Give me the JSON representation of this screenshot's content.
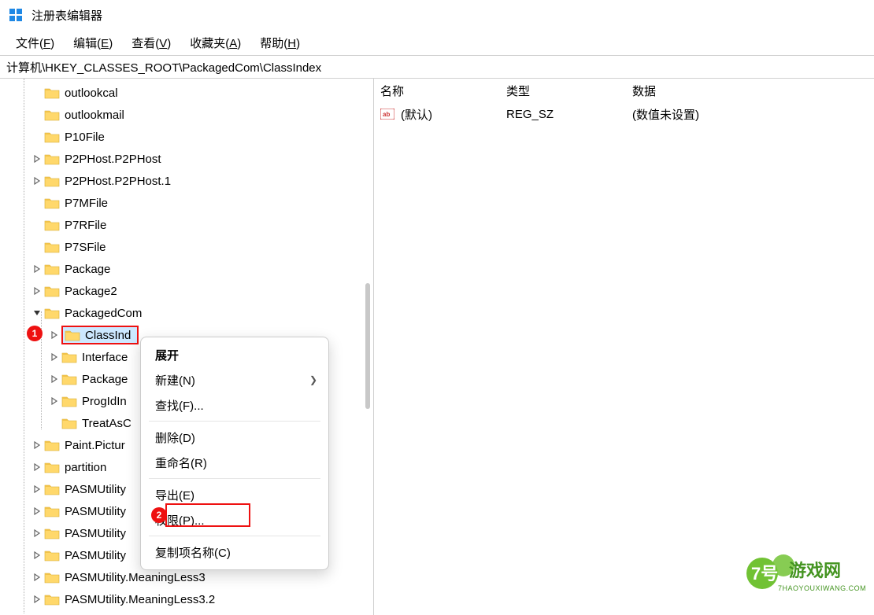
{
  "window": {
    "title": "注册表编辑器"
  },
  "menu": {
    "file": "文件(F)",
    "edit": "编辑(E)",
    "view": "查看(V)",
    "favorites": "收藏夹(A)",
    "help": "帮助(H)"
  },
  "path": "计算机\\HKEY_CLASSES_ROOT\\PackagedCom\\ClassIndex",
  "tree": [
    {
      "label": "outlookcal",
      "indent": 40,
      "exp": ""
    },
    {
      "label": "outlookmail",
      "indent": 40,
      "exp": ""
    },
    {
      "label": "P10File",
      "indent": 40,
      "exp": ""
    },
    {
      "label": "P2PHost.P2PHost",
      "indent": 40,
      "exp": ">"
    },
    {
      "label": "P2PHost.P2PHost.1",
      "indent": 40,
      "exp": ">"
    },
    {
      "label": "P7MFile",
      "indent": 40,
      "exp": ""
    },
    {
      "label": "P7RFile",
      "indent": 40,
      "exp": ""
    },
    {
      "label": "P7SFile",
      "indent": 40,
      "exp": ""
    },
    {
      "label": "Package",
      "indent": 40,
      "exp": ">"
    },
    {
      "label": "Package2",
      "indent": 40,
      "exp": ">"
    },
    {
      "label": "PackagedCom",
      "indent": 40,
      "exp": "v"
    },
    {
      "label": "ClassInd",
      "indent": 62,
      "exp": ">",
      "selected": true
    },
    {
      "label": "Interface",
      "indent": 62,
      "exp": ">"
    },
    {
      "label": "Package",
      "indent": 62,
      "exp": ">"
    },
    {
      "label": "ProgIdIn",
      "indent": 62,
      "exp": ">"
    },
    {
      "label": "TreatAsC",
      "indent": 62,
      "exp": ""
    },
    {
      "label": "Paint.Pictur",
      "indent": 40,
      "exp": ">"
    },
    {
      "label": "partition",
      "indent": 40,
      "exp": ">"
    },
    {
      "label": "PASMUtility",
      "indent": 40,
      "exp": ">"
    },
    {
      "label": "PASMUtility",
      "indent": 40,
      "exp": ">"
    },
    {
      "label": "PASMUtility",
      "indent": 40,
      "exp": ">"
    },
    {
      "label": "PASMUtility",
      "indent": 40,
      "exp": ">"
    },
    {
      "label": "PASMUtility.MeaningLess3",
      "indent": 40,
      "exp": ">"
    },
    {
      "label": "PASMUtility.MeaningLess3.2",
      "indent": 40,
      "exp": ">"
    }
  ],
  "list": {
    "headers": {
      "name": "名称",
      "type": "类型",
      "data": "数据"
    },
    "rows": [
      {
        "name": "(默认)",
        "type": "REG_SZ",
        "data": "(数值未设置)"
      }
    ]
  },
  "context_menu": {
    "expand": "展开",
    "new": "新建(N)",
    "find": "查找(F)...",
    "delete": "删除(D)",
    "rename": "重命名(R)",
    "export": "导出(E)",
    "permissions": "权限(P)...",
    "copy_key_name": "复制项名称(C)"
  },
  "callouts": {
    "one": "1",
    "two": "2"
  },
  "watermark": {
    "brand": "7号",
    "brand2": "游戏网",
    "domain": "7HAOYOUXIWANG.COM"
  }
}
